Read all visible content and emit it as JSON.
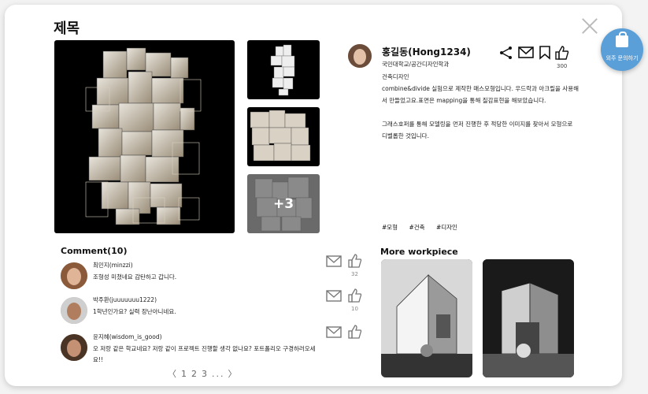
{
  "modal": {
    "title": "제목",
    "close_icon": "close-icon"
  },
  "fab": {
    "label": "외주 문의하기",
    "icon": "shopping-bag-icon",
    "color": "#5b9fd8"
  },
  "gallery": {
    "more_count": "+3"
  },
  "author": {
    "name": "홍길동(Hong1234)",
    "school": "국민대학교/공간디자인학과",
    "major": "건축디자인",
    "description_1": "combine&divide 실험으로 제작한 매스모형입니다. 우드락과 아크릴을 사용해서 만들었고요.표면은 mapping을 통해 질감표현을 해보았습니다.",
    "description_2": "그래스호퍼를 통해 모델링을 먼저 진행한 후 적당한 이미지를 찾아서 모형으로 디벨롭한 것입니다.",
    "likes": "300"
  },
  "tags": [
    "#모형",
    "#건축",
    "#디자인"
  ],
  "comments": {
    "title": "Comment(10)",
    "items": [
      {
        "name": "최민지(minzzi)",
        "text": "조형성 미쳤네요 감탄하고 갑니다.",
        "likes": "32"
      },
      {
        "name": "박주환(juuuuuuu1222)",
        "text": "1학년인가요? 실력 장난아니네요.",
        "likes": "10"
      },
      {
        "name": "윤지혜(wisdom_is_good)",
        "text": "오 저랑 같은 학교네요? 저랑 같이 프로젝트 진행할 생각 없나요? 포트폴리오 구경하러오세요!!",
        "likes": ""
      }
    ]
  },
  "pagination": {
    "prev": "〈",
    "p1": "1",
    "p2": "2",
    "p3": "3",
    "ellipsis": "...",
    "next": "〉"
  },
  "more": {
    "title": "More workpiece"
  }
}
